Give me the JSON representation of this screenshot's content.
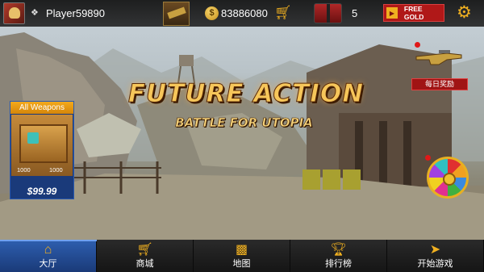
{
  "player": {
    "name": "Player59890"
  },
  "currency": {
    "coins": "83886080",
    "gifts": "5"
  },
  "buttons": {
    "free_gold": "FREE GOLD"
  },
  "title": {
    "main": "FUTURE ACTION",
    "sub": "BATTLE FOR UTOPIA"
  },
  "weapons_panel": {
    "title": "All Weapons",
    "item1": "1000",
    "item2": "1000",
    "price": "$99.99"
  },
  "daily_reward": {
    "label": "每日奖励"
  },
  "nav": [
    {
      "label": "大厅",
      "icon": "home-icon",
      "active": true
    },
    {
      "label": "商城",
      "icon": "cart-icon",
      "active": false
    },
    {
      "label": "地图",
      "icon": "map-icon",
      "active": false
    },
    {
      "label": "排行榜",
      "icon": "trophy-icon",
      "active": false
    },
    {
      "label": "开始游戏",
      "icon": "bullet-icon",
      "active": false
    }
  ],
  "colors": {
    "accent": "#f0b020",
    "nav_active": "#2e5fb0",
    "promo_red": "#b01818",
    "panel_blue": "#1a3a7a"
  }
}
